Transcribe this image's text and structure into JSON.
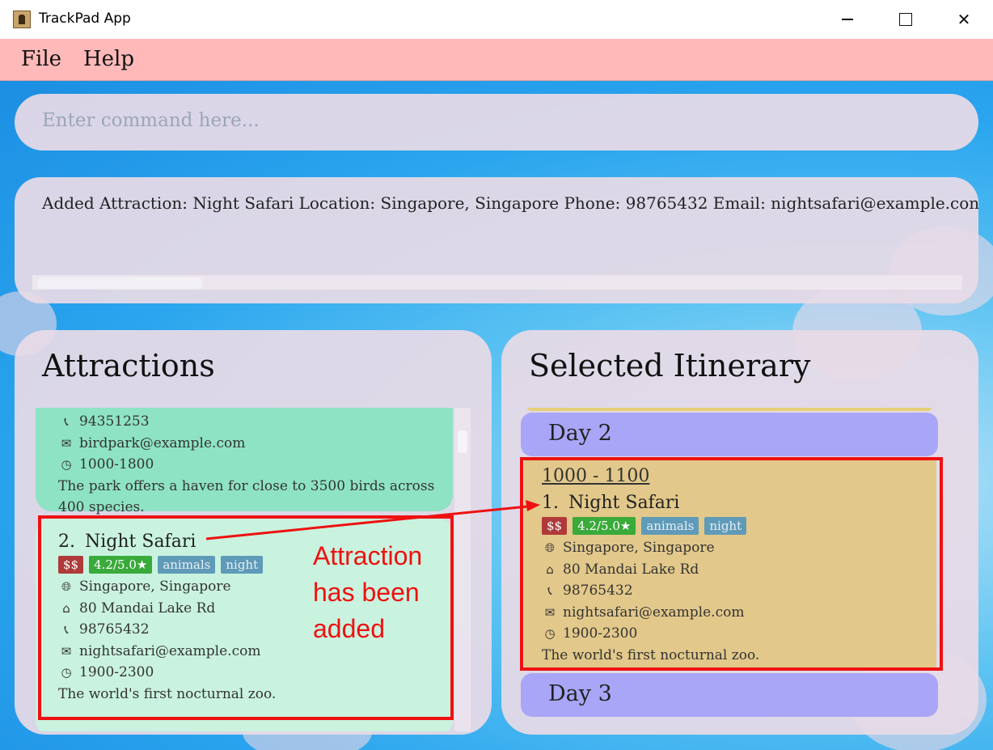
{
  "window": {
    "title": "TrackPad App"
  },
  "menu": {
    "items": [
      "File",
      "Help"
    ]
  },
  "command": {
    "placeholder": "Enter command here..."
  },
  "result": {
    "text": "Added Attraction: Night Safari Location: Singapore, Singapore Phone: 98765432 Email: nightsafari@example.con"
  },
  "attractions": {
    "title": "Attractions",
    "partial_card": {
      "phone": "94351253",
      "email": "birdpark@example.com",
      "hours": "1000-1800",
      "description": "The park offers a haven for close to 3500 birds across 400 species."
    },
    "card": {
      "index": "2.",
      "name": "Night Safari",
      "price": "$$",
      "rating": "4.2/5.0★",
      "tags": [
        "animals",
        "night"
      ],
      "location": "Singapore, Singapore",
      "address": "80 Mandai Lake Rd",
      "phone": "98765432",
      "email": "nightsafari@example.com",
      "hours": "1900-2300",
      "description": "The world's first nocturnal zoo."
    }
  },
  "itinerary": {
    "title": "Selected Itinerary",
    "day2": "Day 2",
    "day3": "Day 3",
    "slot": {
      "time": "1000 - 1100",
      "index": "1.",
      "name": "Night Safari",
      "price": "$$",
      "rating": "4.2/5.0★",
      "tags": [
        "animals",
        "night"
      ],
      "location": "Singapore, Singapore",
      "address": "80 Mandai Lake Rd",
      "phone": "98765432",
      "email": "nightsafari@example.com",
      "hours": "1900-2300",
      "description": "The world's first nocturnal zoo."
    }
  },
  "annotation": {
    "lines": [
      "Attraction",
      "has been",
      "added"
    ],
    "color": "#ee1111"
  },
  "icons": {
    "phone": "phone-icon",
    "email": "email-icon",
    "clock": "clock-icon",
    "globe": "globe-icon",
    "home": "home-icon"
  }
}
